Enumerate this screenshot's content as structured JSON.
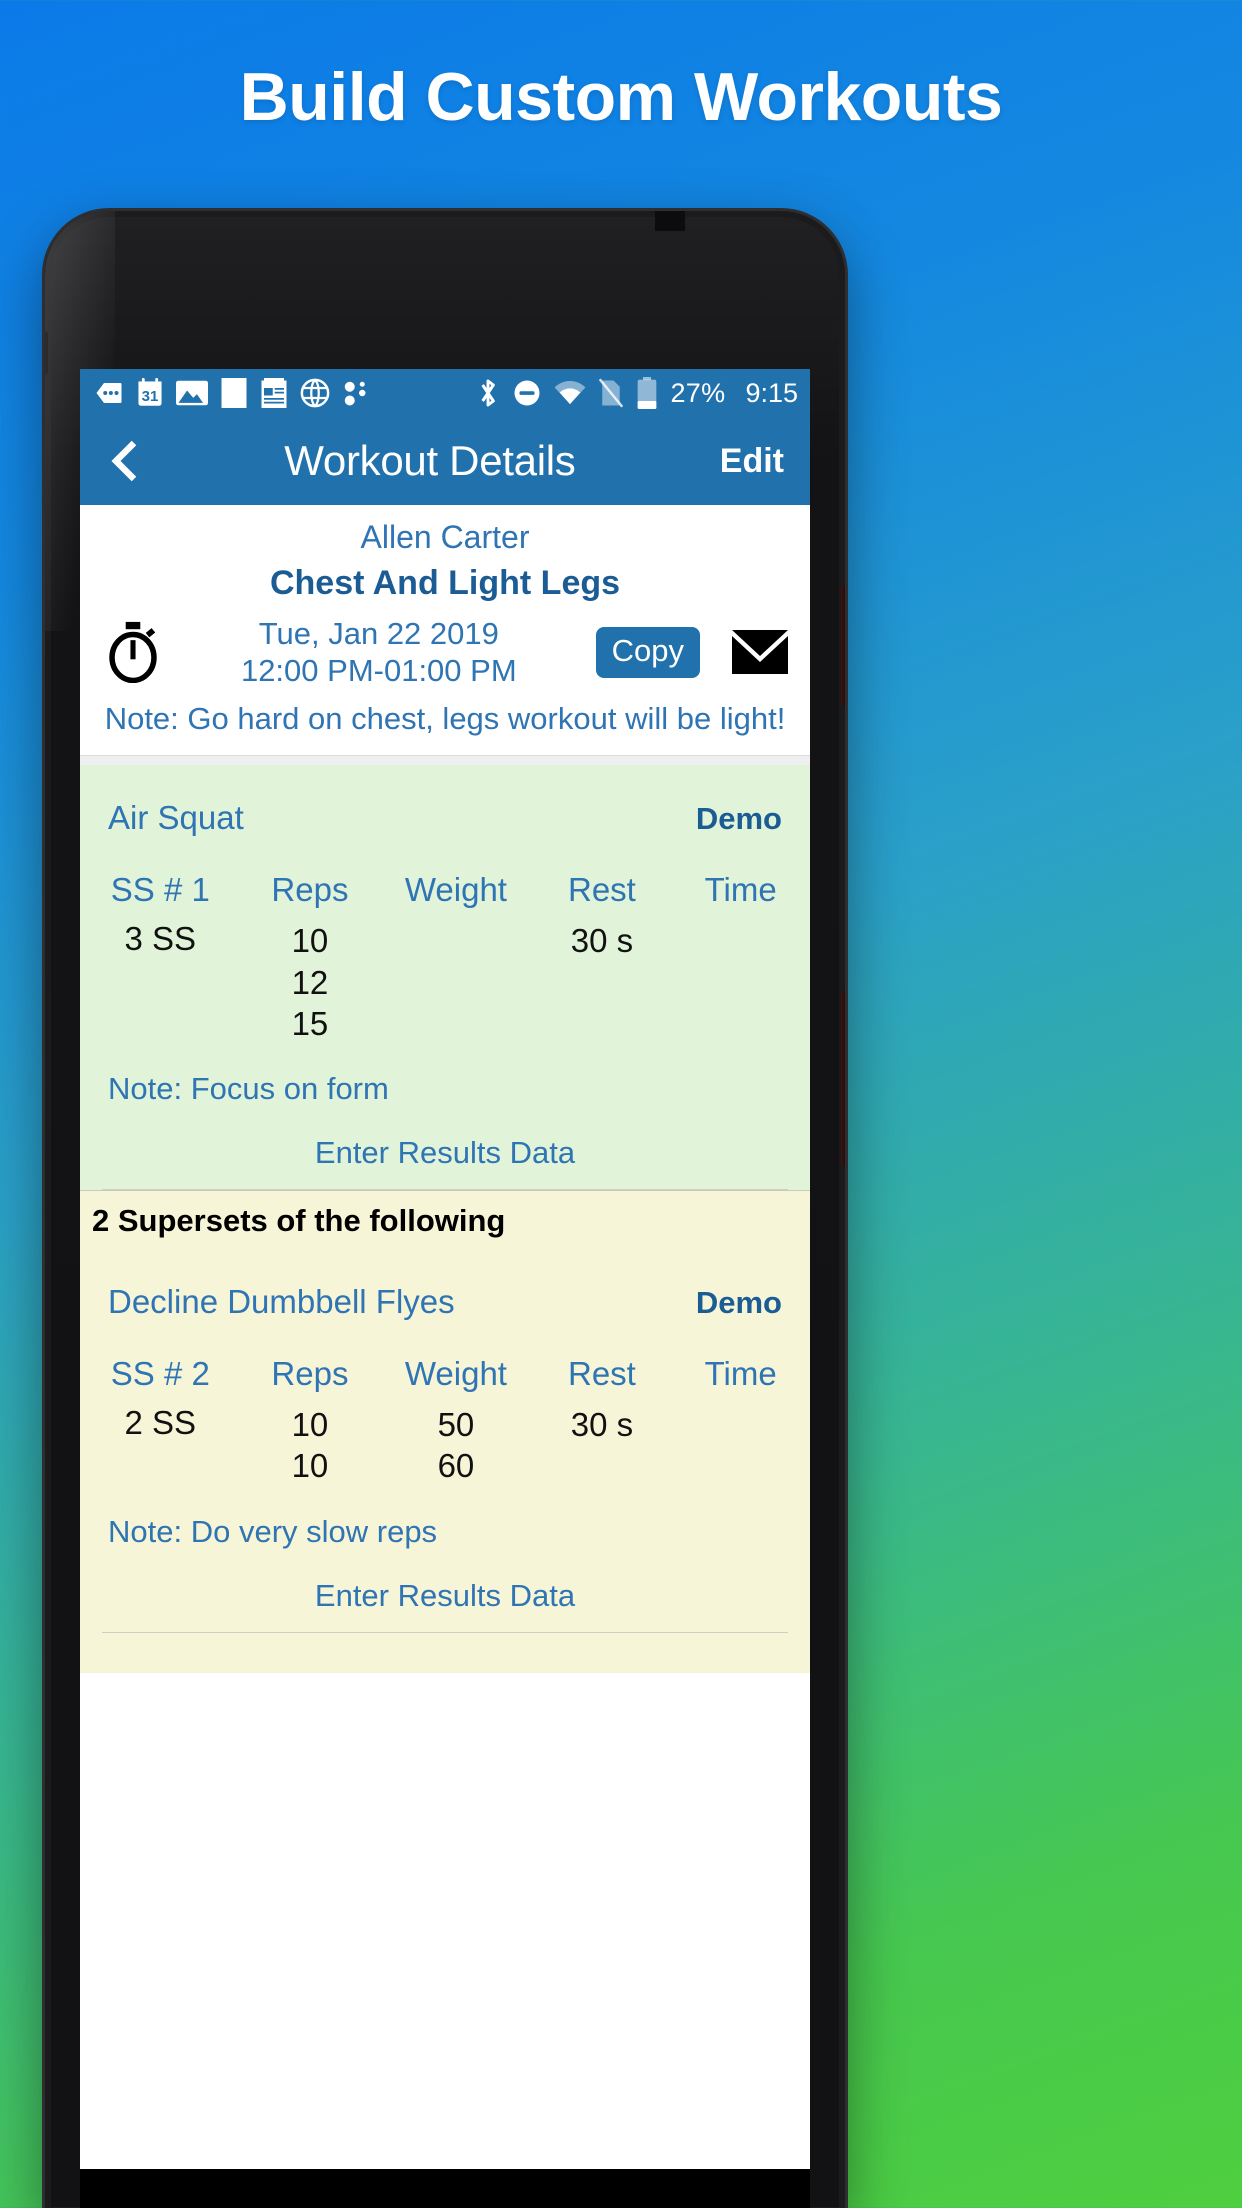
{
  "headline": "Build Custom Workouts",
  "statusbar": {
    "left_icons": [
      "more-messages-icon",
      "calendar-31-icon",
      "photo-icon",
      "blank-note-icon",
      "notepad-icon",
      "globe-icon",
      "dots-icon"
    ],
    "right_icons": [
      "bluetooth-icon",
      "do-not-disturb-icon",
      "wifi-icon",
      "sim-off-icon",
      "battery-icon"
    ],
    "battery_percent": "27%",
    "time": "9:15"
  },
  "navbar": {
    "back_icon": "back-chevron-icon",
    "title": "Workout Details",
    "edit_label": "Edit"
  },
  "workout": {
    "client_name": "Allen Carter",
    "name": "Chest And Light Legs",
    "timer_icon": "stopwatch-icon",
    "date": "Tue, Jan 22 2019",
    "time_range": "12:00 PM-01:00 PM",
    "copy_label": "Copy",
    "mail_icon": "envelope-icon",
    "note": "Note: Go hard on chest, legs workout will be light!"
  },
  "columns": [
    "Reps",
    "Weight",
    "Rest",
    "Time"
  ],
  "exercises": [
    {
      "name": "Air Squat",
      "demo_label": "Demo",
      "set_header": "SS # 1",
      "set_count": "3 SS",
      "reps": "10\n12\n15",
      "weight": "",
      "rest": "30 s",
      "time": "",
      "note": "Note: Focus on form",
      "enter_results_label": "Enter Results Data"
    },
    {
      "name": "Decline Dumbbell Flyes",
      "demo_label": "Demo",
      "set_header": "SS # 2",
      "set_count": "2 SS",
      "reps": "10\n10",
      "weight": "50\n60",
      "rest": "30 s",
      "time": "",
      "note": "Note: Do very slow reps",
      "enter_results_label": "Enter Results Data"
    }
  ],
  "superset_band": "2 Supersets of the following",
  "colors": {
    "brand_blue": "#2171ad",
    "link_blue": "#2f74b3",
    "green_block": "#e1f3d9",
    "cream_block": "#f7f5d8"
  }
}
